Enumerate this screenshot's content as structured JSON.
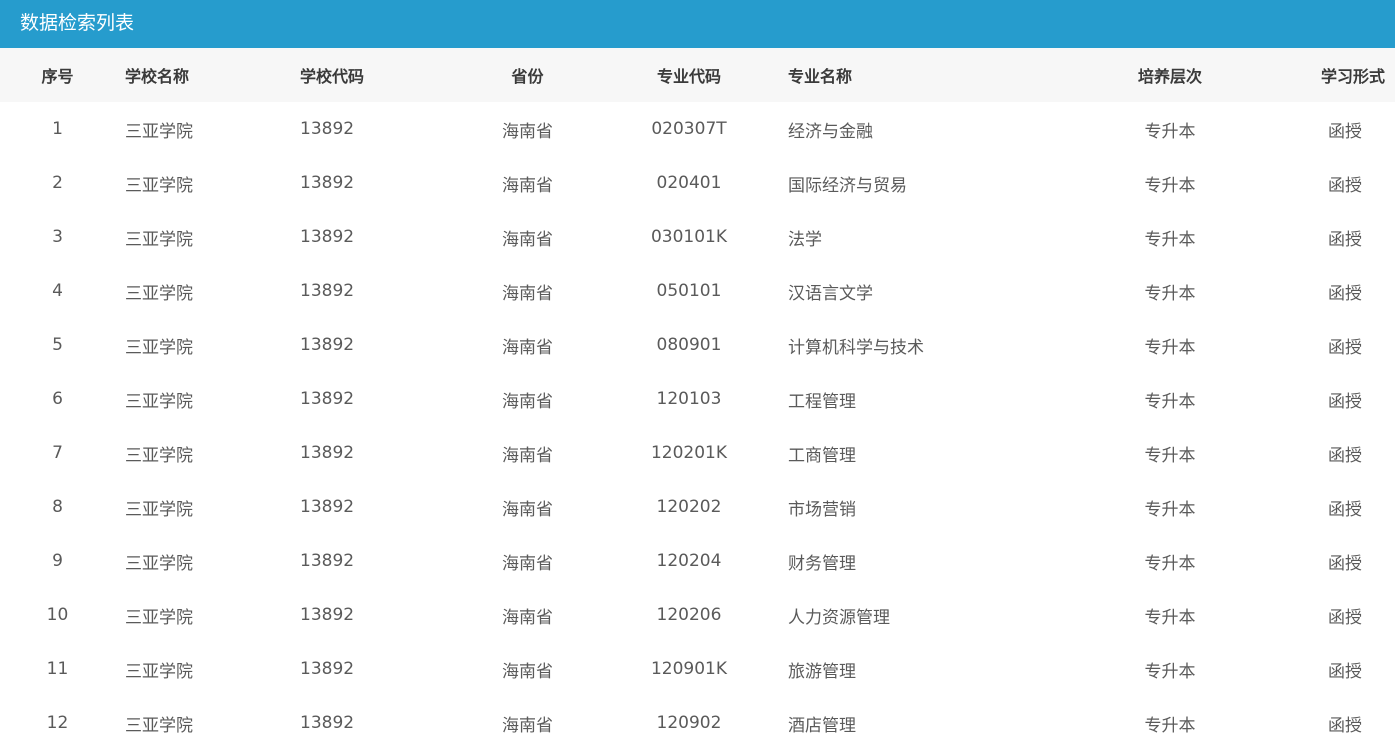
{
  "panel": {
    "title": "数据检索列表"
  },
  "table": {
    "headers": [
      "序号",
      "学校名称",
      "学校代码",
      "省份",
      "专业代码",
      "专业名称",
      "培养层次",
      "学习形式"
    ],
    "rows": [
      [
        "1",
        "三亚学院",
        "13892",
        "海南省",
        "020307T",
        "经济与金融",
        "专升本",
        "函授"
      ],
      [
        "2",
        "三亚学院",
        "13892",
        "海南省",
        "020401",
        "国际经济与贸易",
        "专升本",
        "函授"
      ],
      [
        "3",
        "三亚学院",
        "13892",
        "海南省",
        "030101K",
        "法学",
        "专升本",
        "函授"
      ],
      [
        "4",
        "三亚学院",
        "13892",
        "海南省",
        "050101",
        "汉语言文学",
        "专升本",
        "函授"
      ],
      [
        "5",
        "三亚学院",
        "13892",
        "海南省",
        "080901",
        "计算机科学与技术",
        "专升本",
        "函授"
      ],
      [
        "6",
        "三亚学院",
        "13892",
        "海南省",
        "120103",
        "工程管理",
        "专升本",
        "函授"
      ],
      [
        "7",
        "三亚学院",
        "13892",
        "海南省",
        "120201K",
        "工商管理",
        "专升本",
        "函授"
      ],
      [
        "8",
        "三亚学院",
        "13892",
        "海南省",
        "120202",
        "市场营销",
        "专升本",
        "函授"
      ],
      [
        "9",
        "三亚学院",
        "13892",
        "海南省",
        "120204",
        "财务管理",
        "专升本",
        "函授"
      ],
      [
        "10",
        "三亚学院",
        "13892",
        "海南省",
        "120206",
        "人力资源管理",
        "专升本",
        "函授"
      ],
      [
        "11",
        "三亚学院",
        "13892",
        "海南省",
        "120901K",
        "旅游管理",
        "专升本",
        "函授"
      ],
      [
        "12",
        "三亚学院",
        "13892",
        "海南省",
        "120902",
        "酒店管理",
        "专升本",
        "函授"
      ]
    ]
  },
  "colors": {
    "header_bar": "#269ccd",
    "thead_bg": "#f7f7f7"
  }
}
